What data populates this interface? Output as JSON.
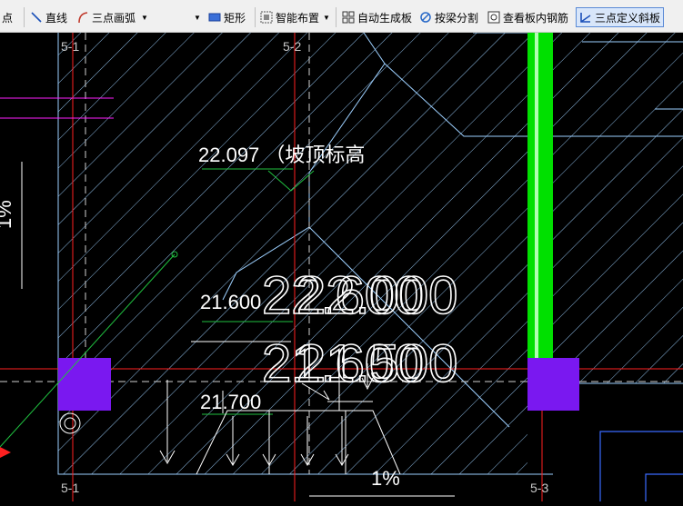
{
  "toolbar": {
    "items": [
      {
        "label": "点",
        "icon": "point-icon"
      },
      {
        "label": "直线",
        "icon": "line-icon"
      },
      {
        "label": "三点画弧",
        "icon": "arc-icon"
      },
      {
        "label": "矩形",
        "icon": "rectangle-icon"
      },
      {
        "label": "智能布置",
        "icon": "smart-layout-icon"
      },
      {
        "label": "自动生成板",
        "icon": "auto-slab-icon"
      },
      {
        "label": "按梁分割",
        "icon": "split-by-beam-icon"
      },
      {
        "label": "查看板内钢筋",
        "icon": "view-rebar-icon"
      },
      {
        "label": "三点定义斜板",
        "icon": "three-point-slope-icon"
      }
    ]
  },
  "drawing": {
    "axis_labels": {
      "a": "5-1",
      "b": "5-2",
      "c": "5-1",
      "d": "5-3"
    },
    "slab_top_label": "22.097 （坡顶标高",
    "elev_21600": "21.600",
    "elev_21700": "21.700",
    "big_value_1": "22.600",
    "big_value_2": "22.000",
    "big_value_3": "21.600",
    "big_value_4": "21.500",
    "slope_left": "1%",
    "slope_bottom": "1%"
  },
  "colors": {
    "hatch": "#9dd0ff",
    "axis": "#ff2020",
    "column": "#7a18f0",
    "green_beam": "#00e000",
    "magenta": "#ff20ff"
  }
}
